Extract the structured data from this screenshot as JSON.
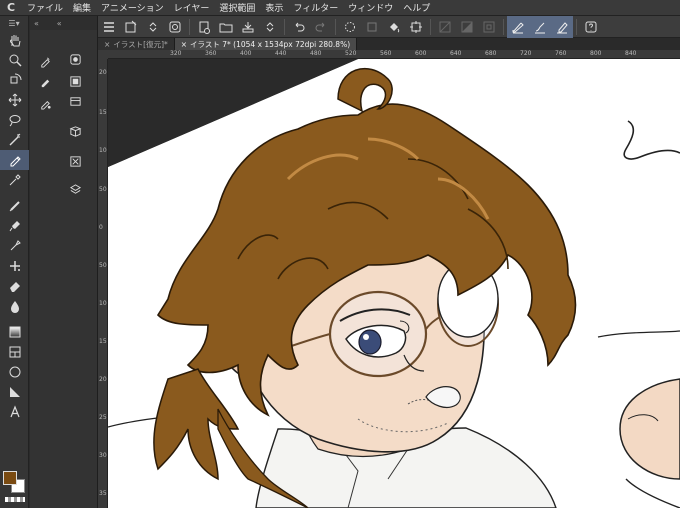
{
  "app": {
    "logo": "C"
  },
  "menu": [
    "ファイル",
    "編集",
    "アニメーション",
    "レイヤー",
    "選択範囲",
    "表示",
    "フィルター",
    "ウィンドウ",
    "ヘルプ"
  ],
  "tabs": [
    {
      "label": "イラスト[復元]*",
      "active": false
    },
    {
      "label": "イラスト 7* (1054 x 1534px 72dpi 280.8%)",
      "active": true
    }
  ],
  "ruler_h": [
    "320",
    "360",
    "400",
    "440",
    "480",
    "520",
    "560",
    "600",
    "640",
    "680",
    "720",
    "760",
    "800",
    "840"
  ],
  "ruler_v": [
    "200",
    "150",
    "100",
    "50",
    "0",
    "50",
    "100",
    "150",
    "200",
    "250",
    "300",
    "350"
  ],
  "colors": {
    "main": "#7a4b12",
    "sub": "#ffffff",
    "active_tool": "#4e5c74",
    "active_cmd": "#5a6a85"
  },
  "tools": [
    "hand-icon",
    "zoom-icon",
    "rotate-icon",
    "move-icon",
    "lasso-icon",
    "magic-wand-icon",
    "eyedropper-icon",
    "pen-icon",
    "pencil-icon",
    "brush-icon",
    "airbrush-icon",
    "decoration-icon",
    "eraser-icon",
    "fill-icon",
    "gradient-icon",
    "frame-icon",
    "figure-icon",
    "ruler-icon",
    "text-icon"
  ],
  "subtools": [
    "g-pen-icon",
    "mapping-pen-icon",
    "turnip-pen-icon",
    "layer-icon",
    "layer-mask-icon",
    "material-icon",
    "object-icon",
    "stack-icon"
  ]
}
